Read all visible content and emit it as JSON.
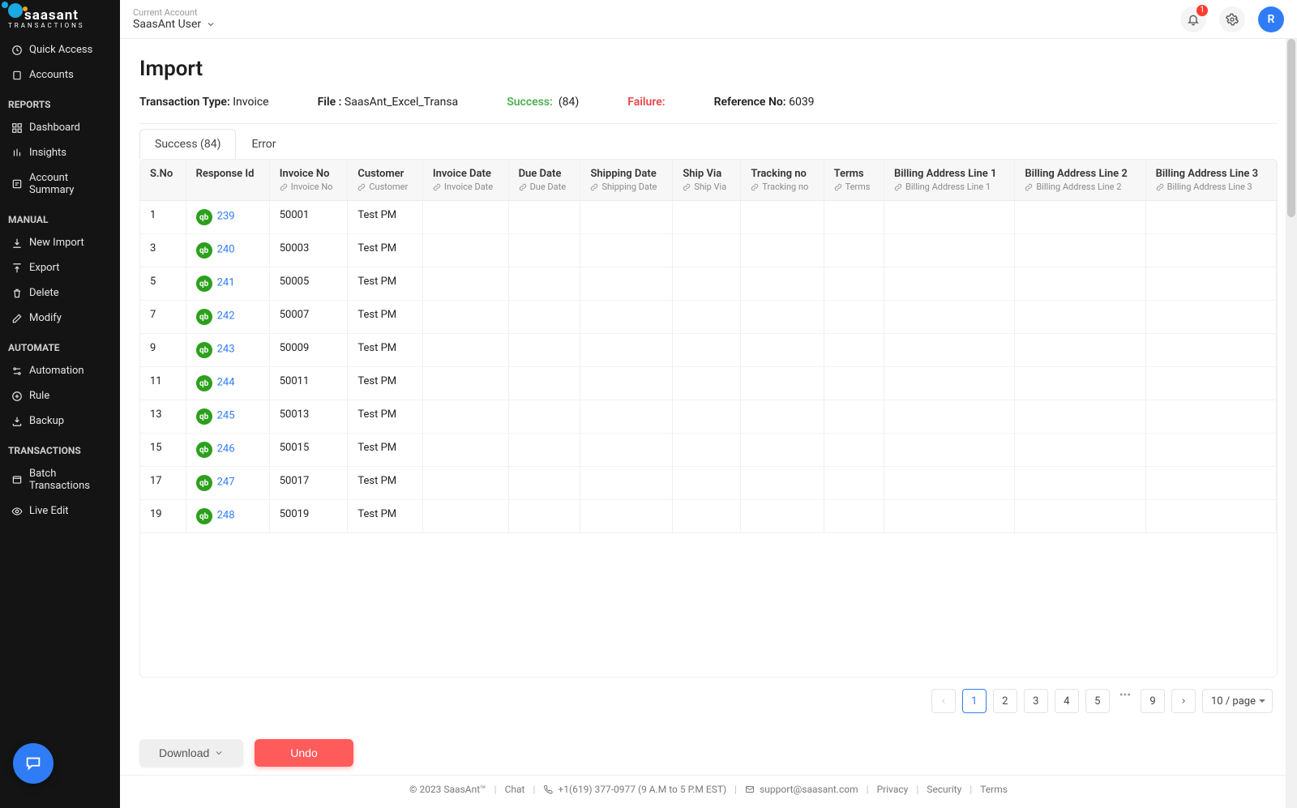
{
  "brand": {
    "name": "saasant",
    "sub": "TRANSACTIONS"
  },
  "account": {
    "label": "Current Account",
    "name": "SaasAnt User"
  },
  "topbar": {
    "notif_count": "1",
    "avatar_letter": "R"
  },
  "sidebar": {
    "items": [
      {
        "label": "Quick Access"
      },
      {
        "label": "Accounts"
      }
    ],
    "sections": [
      {
        "title": "REPORTS",
        "items": [
          {
            "label": "Dashboard"
          },
          {
            "label": "Insights"
          },
          {
            "label": "Account Summary"
          }
        ]
      },
      {
        "title": "MANUAL",
        "items": [
          {
            "label": "New Import"
          },
          {
            "label": "Export"
          },
          {
            "label": "Delete"
          },
          {
            "label": "Modify"
          }
        ]
      },
      {
        "title": "AUTOMATE",
        "items": [
          {
            "label": "Automation"
          },
          {
            "label": "Rule"
          },
          {
            "label": "Backup"
          }
        ]
      },
      {
        "title": "TRANSACTIONS",
        "items": [
          {
            "label": "Batch Transactions"
          },
          {
            "label": "Live Edit"
          }
        ]
      }
    ]
  },
  "page": {
    "title": "Import",
    "meta": {
      "txn_type_label": "Transaction Type:",
      "txn_type": "Invoice",
      "file_label": "File :",
      "file": "SaasAnt_Excel_Transa",
      "success_label": "Success:",
      "success_count": "(84)",
      "failure_label": "Failure:",
      "ref_label": "Reference No:",
      "ref": "6039"
    },
    "tabs": {
      "success": "Success (84)",
      "error": "Error"
    }
  },
  "table": {
    "headers": [
      {
        "title": "S.No"
      },
      {
        "title": "Response Id"
      },
      {
        "title": "Invoice No",
        "sub": "Invoice No"
      },
      {
        "title": "Customer",
        "sub": "Customer"
      },
      {
        "title": "Invoice Date",
        "sub": "Invoice Date"
      },
      {
        "title": "Due Date",
        "sub": "Due Date"
      },
      {
        "title": "Shipping Date",
        "sub": "Shipping Date"
      },
      {
        "title": "Ship Via",
        "sub": "Ship Via"
      },
      {
        "title": "Tracking no",
        "sub": "Tracking no"
      },
      {
        "title": "Terms",
        "sub": "Terms"
      },
      {
        "title": "Billing Address Line 1",
        "sub": "Billing Address Line 1"
      },
      {
        "title": "Billing Address Line 2",
        "sub": "Billing Address Line 2"
      },
      {
        "title": "Billing Address Line 3",
        "sub": "Billing Address Line 3"
      }
    ],
    "rows": [
      {
        "sno": "1",
        "resp": "239",
        "inv": "50001",
        "cust": "Test PM"
      },
      {
        "sno": "3",
        "resp": "240",
        "inv": "50003",
        "cust": "Test PM"
      },
      {
        "sno": "5",
        "resp": "241",
        "inv": "50005",
        "cust": "Test PM"
      },
      {
        "sno": "7",
        "resp": "242",
        "inv": "50007",
        "cust": "Test PM"
      },
      {
        "sno": "9",
        "resp": "243",
        "inv": "50009",
        "cust": "Test PM"
      },
      {
        "sno": "11",
        "resp": "244",
        "inv": "50011",
        "cust": "Test PM"
      },
      {
        "sno": "13",
        "resp": "245",
        "inv": "50013",
        "cust": "Test PM"
      },
      {
        "sno": "15",
        "resp": "246",
        "inv": "50015",
        "cust": "Test PM"
      },
      {
        "sno": "17",
        "resp": "247",
        "inv": "50017",
        "cust": "Test PM"
      },
      {
        "sno": "19",
        "resp": "248",
        "inv": "50019",
        "cust": "Test PM"
      }
    ]
  },
  "pager": {
    "pages": [
      "1",
      "2",
      "3",
      "4",
      "5",
      "9"
    ],
    "size": "10 / page",
    "ellipsis": "•••"
  },
  "actions": {
    "download": "Download",
    "undo": "Undo"
  },
  "footer": {
    "copyright": "© 2023 SaasAnt™",
    "chat": "Chat",
    "phone": "+1(619) 377-0977 (9 A.M to 5 P.M EST)",
    "email": "support@saasant.com",
    "privacy": "Privacy",
    "security": "Security",
    "terms": "Terms"
  }
}
